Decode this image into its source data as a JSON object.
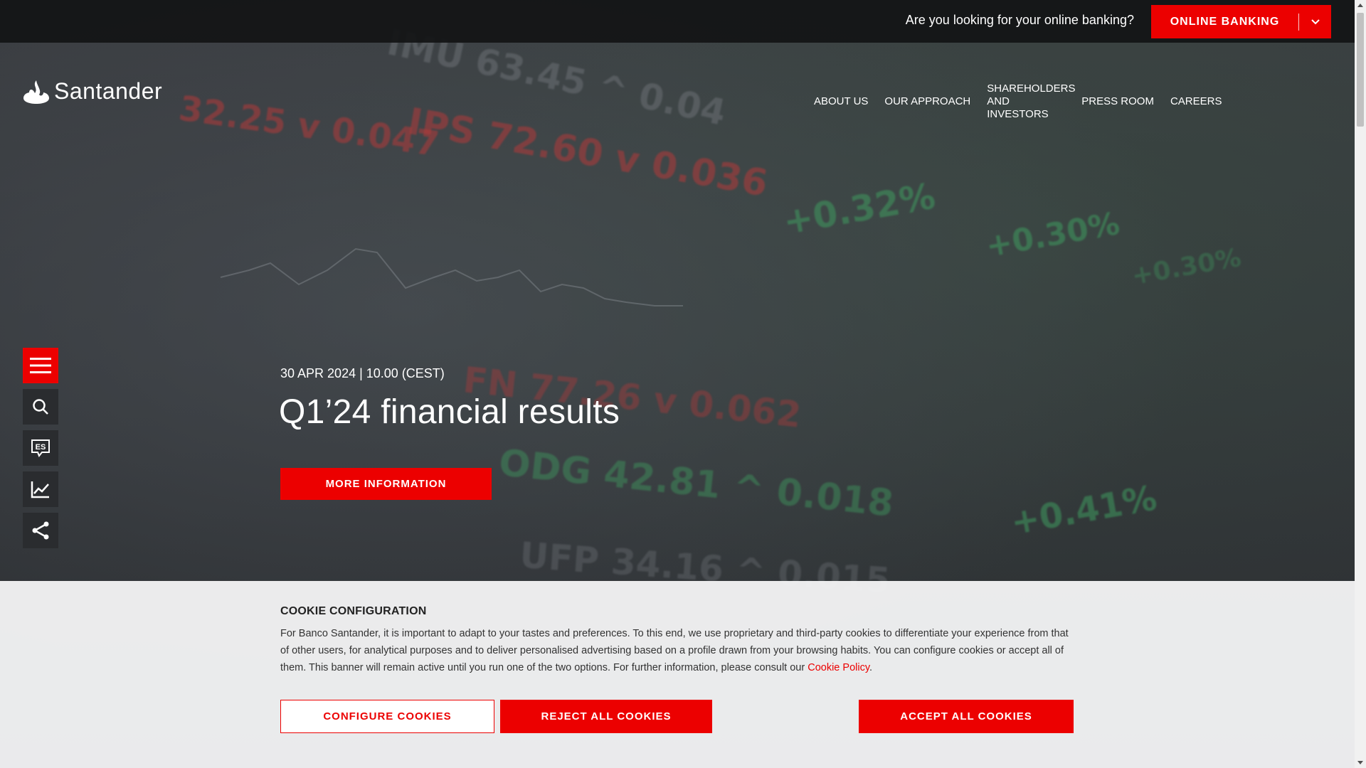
{
  "topbar": {
    "question": "Are you looking for your online banking?",
    "online_banking_label": "ONLINE BANKING"
  },
  "brand": {
    "name": "Santander"
  },
  "nav": {
    "items": [
      {
        "label": "ABOUT US"
      },
      {
        "label": "OUR APPROACH"
      },
      {
        "label": "SHAREHOLDERS AND INVESTORS"
      },
      {
        "label": "PRESS ROOM"
      },
      {
        "label": "CAREERS"
      }
    ]
  },
  "side_toolbar": {
    "icons": [
      "menu-icon",
      "search-icon",
      "language-es-icon",
      "chart-icon",
      "share-icon"
    ],
    "language_code": "ES"
  },
  "hero": {
    "date": "30 APR 2024 | 10.00 (CEST)",
    "title": "Q1’24  financial results",
    "button_label": "MORE INFORMATION",
    "background_tickers": [
      {
        "text": "IMU 63.45 ^ 0.04",
        "color": "grey"
      },
      {
        "text": "IPS 72.60 v 0.036",
        "color": "red"
      },
      {
        "text": "32.25 v 0.047",
        "color": "red"
      },
      {
        "text": "+0.32%",
        "color": "green"
      },
      {
        "text": "+0.30%",
        "color": "green"
      },
      {
        "text": "+0.30%",
        "color": "green"
      },
      {
        "text": "FN 77.26 v 0.062",
        "color": "red"
      },
      {
        "text": "ODG 42.81 ^ 0.018",
        "color": "green"
      },
      {
        "text": "+0.41%",
        "color": "green"
      },
      {
        "text": "UFP 34.16 ^ 0.015",
        "color": "grey"
      }
    ]
  },
  "cookie_banner": {
    "title": "COOKIE CONFIGURATION",
    "text": "For Banco Santander, it is important to adapt to your tastes and preferences. To this end, we use proprietary and third-party cookies to differentiate your experience from that of other users, for analytical purposes and to deliver personalised advertising based on a profile drawn from your browsing habits. You can configure cookies or accept all of them. This banner will remain active until you run one of the two options. For further information, please consult our ",
    "link_label": "Cookie Policy",
    "text_end": ".",
    "configure_label": "CONFIGURE COOKIES",
    "reject_label": "REJECT ALL COOKIES",
    "accept_label": "ACCEPT ALL COOKIES"
  },
  "colors": {
    "brand_red": "#ec0000",
    "topbar_bg": "#121315",
    "cookie_bg": "#f3f3f4"
  }
}
